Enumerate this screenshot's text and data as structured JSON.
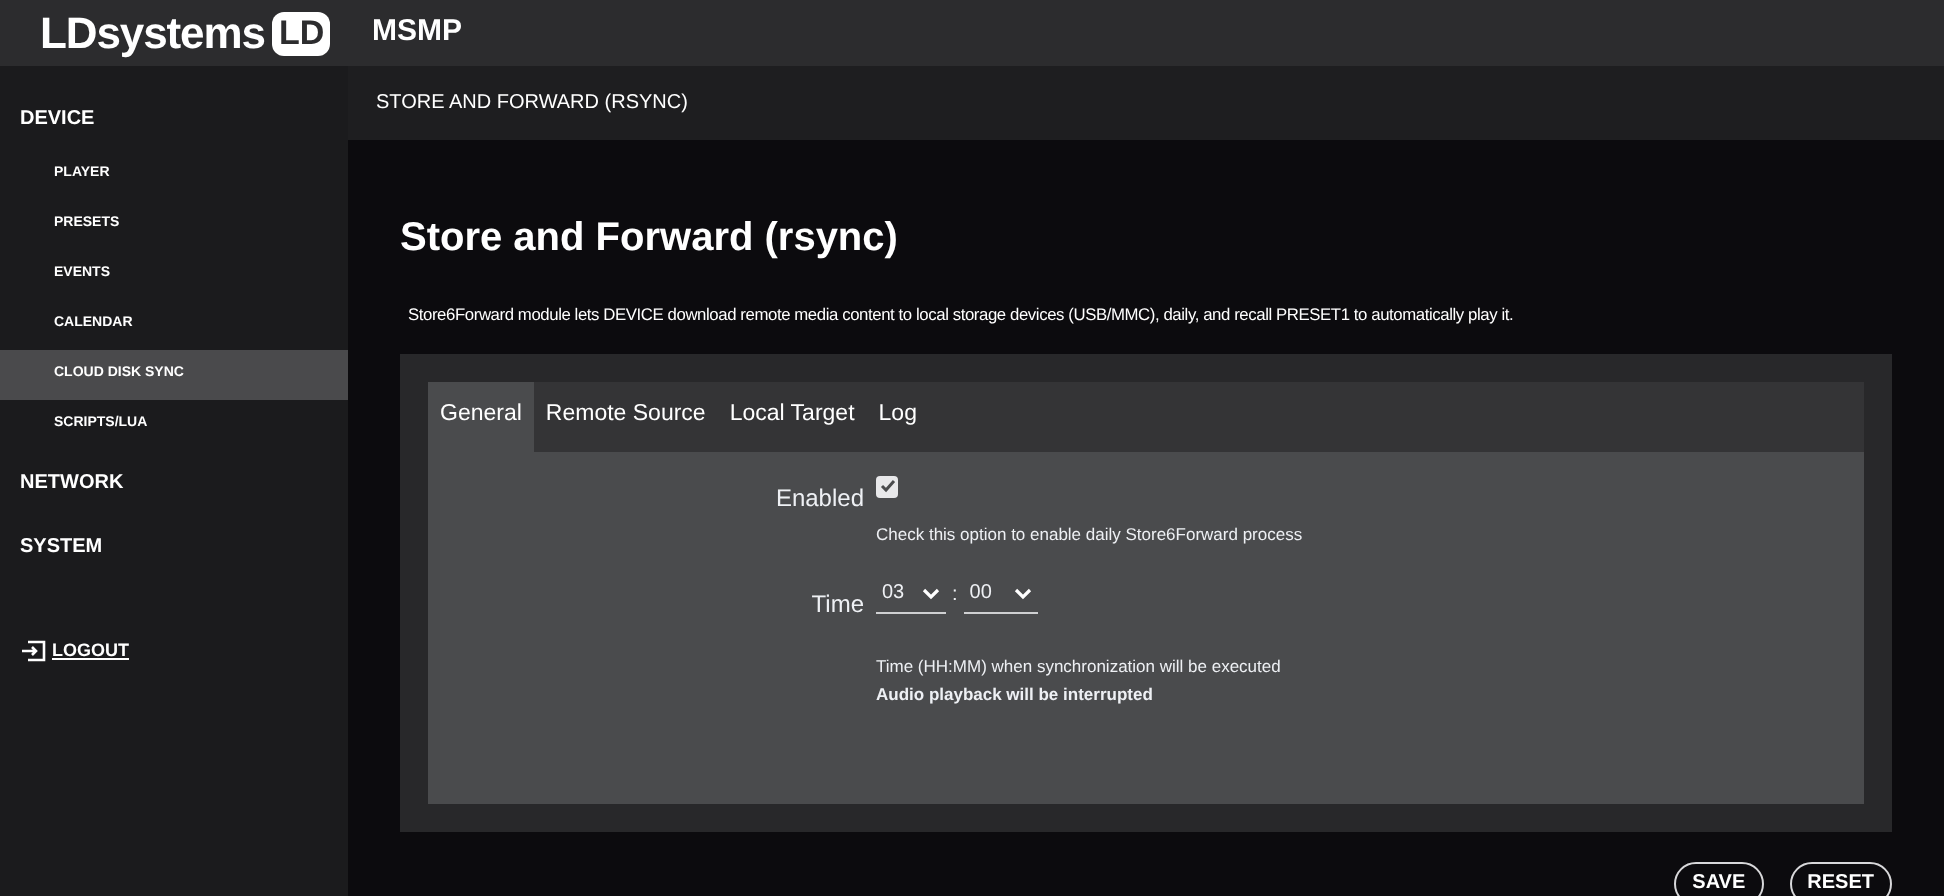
{
  "header": {
    "logo_text": "LDsystems",
    "logo_badge": "LD",
    "app_title": "MSMP"
  },
  "sidebar": {
    "items": [
      {
        "label": "DEVICE",
        "selected": false,
        "children": [
          {
            "label": "PLAYER",
            "selected": false
          },
          {
            "label": "PRESETS",
            "selected": false
          },
          {
            "label": "EVENTS",
            "selected": false
          },
          {
            "label": "CALENDAR",
            "selected": false
          },
          {
            "label": "CLOUD DISK SYNC",
            "selected": true
          },
          {
            "label": "SCRIPTS/LUA",
            "selected": false
          }
        ]
      },
      {
        "label": "NETWORK",
        "selected": false
      },
      {
        "label": "SYSTEM",
        "selected": false
      }
    ],
    "logout": "LOGOUT"
  },
  "breadcrumb": "STORE AND FORWARD (RSYNC)",
  "page": {
    "title": "Store and Forward (rsync)",
    "description": "Store6Forward module lets DEVICE download remote media content to local storage devices (USB/MMC), daily, and recall PRESET1 to automatically play it."
  },
  "tabs": [
    {
      "label": "General",
      "selected": true
    },
    {
      "label": "Remote Source",
      "selected": false
    },
    {
      "label": "Local Target",
      "selected": false
    },
    {
      "label": "Log",
      "selected": false
    }
  ],
  "form": {
    "enabled": {
      "label": "Enabled",
      "checked": true,
      "help": "Check this option to enable daily Store6Forward process"
    },
    "time": {
      "label": "Time",
      "hour": "03",
      "separator": ":",
      "minute": "00",
      "help": "Time (HH:MM) when synchronization will be executed",
      "warning": "Audio playback will be interrupted"
    }
  },
  "buttons": [
    "SAVE",
    "RESET"
  ]
}
